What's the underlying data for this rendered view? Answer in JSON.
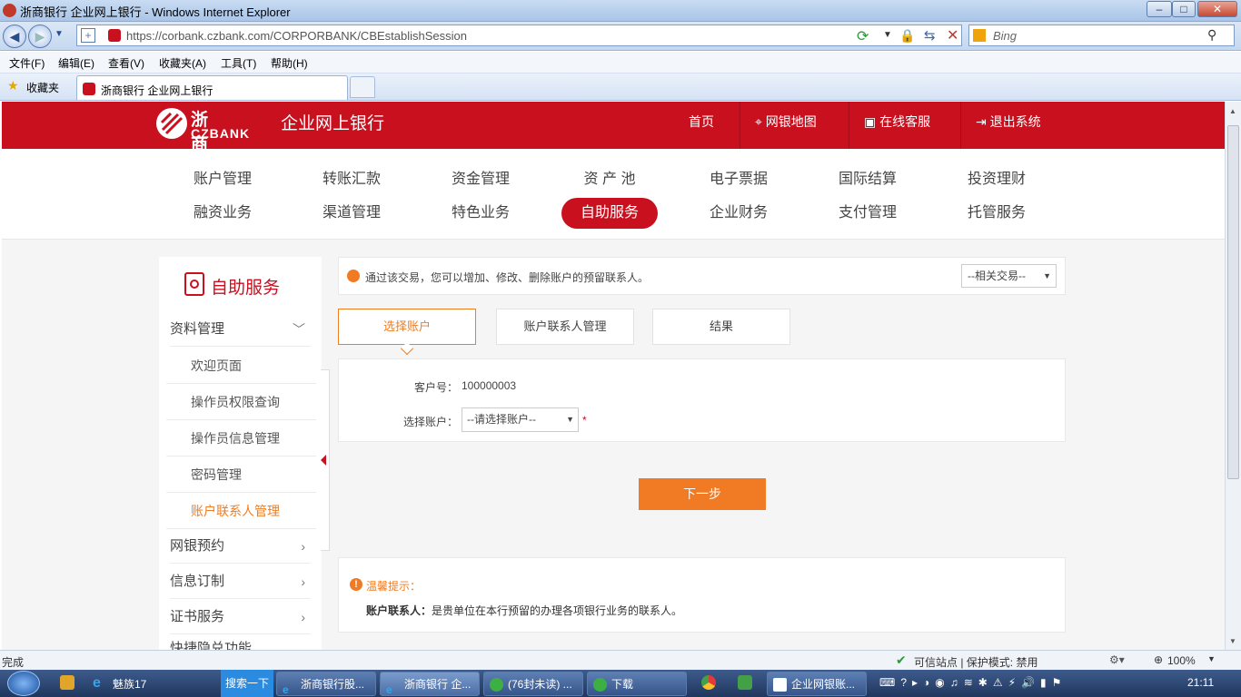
{
  "window": {
    "title": "浙商银行 企业网上银行 - Windows Internet Explorer",
    "min": "–",
    "max": "□",
    "close": "✕"
  },
  "address": {
    "url": "https://corbank.czbank.com/CORPORBANK/CBEstablishSession",
    "search_placeholder": "Bing"
  },
  "menu": [
    "文件(F)",
    "编辑(E)",
    "查看(V)",
    "收藏夹(A)",
    "工具(T)",
    "帮助(H)"
  ],
  "favorites": {
    "label": "收藏夹",
    "tab_title": "浙商银行 企业网上银行"
  },
  "header": {
    "logo_cn": "浙商银行",
    "logo_en": "CZBANK",
    "title": "企业网上银行",
    "nav": [
      {
        "label": "首页",
        "icon": ""
      },
      {
        "label": "网银地图",
        "icon": "map-pin-icon"
      },
      {
        "label": "在线客服",
        "icon": "chat-icon"
      },
      {
        "label": "退出系统",
        "icon": "logout-icon"
      }
    ]
  },
  "mainnav": {
    "row1": [
      "账户管理",
      "转账汇款",
      "资金管理",
      "资 产 池",
      "电子票据",
      "国际结算",
      "投资理财"
    ],
    "row2": [
      "融资业务",
      "渠道管理",
      "特色业务",
      "自助服务",
      "企业财务",
      "支付管理",
      "托管服务"
    ],
    "active": "自助服务"
  },
  "sidebar": {
    "title": "自助服务",
    "groups": [
      {
        "label": "资料管理",
        "expanded": true,
        "items": [
          "欢迎页面",
          "操作员权限查询",
          "操作员信息管理",
          "密码管理",
          "账户联系人管理"
        ]
      },
      {
        "label": "网银预约"
      },
      {
        "label": "信息订制"
      },
      {
        "label": "证书服务"
      },
      {
        "label": "快捷隐兑功能"
      }
    ],
    "active_item": "账户联系人管理"
  },
  "tip": {
    "text": "通过该交易，您可以增加、修改、删除账户的预留联系人。",
    "related": "--相关交易--"
  },
  "steps": [
    "选择账户",
    "账户联系人管理",
    "结果"
  ],
  "form": {
    "cust_label": "客户号：",
    "cust_value": "100000003",
    "acct_label": "选择账户：",
    "acct_select": "--请选择账户--",
    "required": "*"
  },
  "next_button": "下一步",
  "notice": {
    "title": "温馨提示：",
    "label": "账户联系人：",
    "text": "是贵单位在本行预留的办理各项银行业务的联系人。"
  },
  "status": {
    "left": "完成",
    "zone": "可信站点 | 保护模式: 禁用",
    "zoom": "100%"
  },
  "taskbar": {
    "buttons": [
      "魅族17",
      "搜索一下",
      "浙商银行股...",
      "浙商银行 企...",
      "(76封未读) ...",
      "下载",
      "企业网银账..."
    ],
    "clock": "21:11"
  },
  "colors": {
    "brand_red": "#c8101f",
    "accent_orange": "#f17b24"
  }
}
